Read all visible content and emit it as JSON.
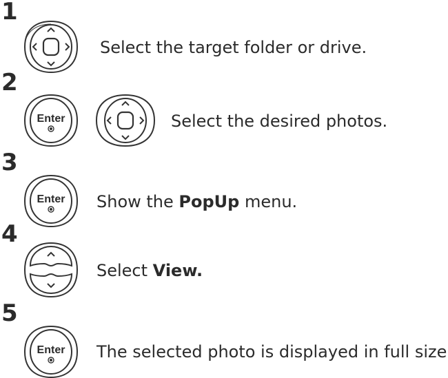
{
  "steps": [
    {
      "number": "1",
      "text": "Select the target folder or drive."
    },
    {
      "number": "2",
      "text": "Select the desired photos."
    },
    {
      "number": "3",
      "text_before": "Show the ",
      "text_bold": "PopUp",
      "text_after": " menu."
    },
    {
      "number": "4",
      "text_before": "Select ",
      "text_bold": "View."
    },
    {
      "number": "5",
      "text": "The selected photo is displayed in full size."
    }
  ],
  "buttons": {
    "enter_label": "Enter"
  },
  "icons": {
    "nav": "navigation-pad-icon",
    "enter": "enter-button-icon",
    "updown": "up-down-button-icon"
  }
}
